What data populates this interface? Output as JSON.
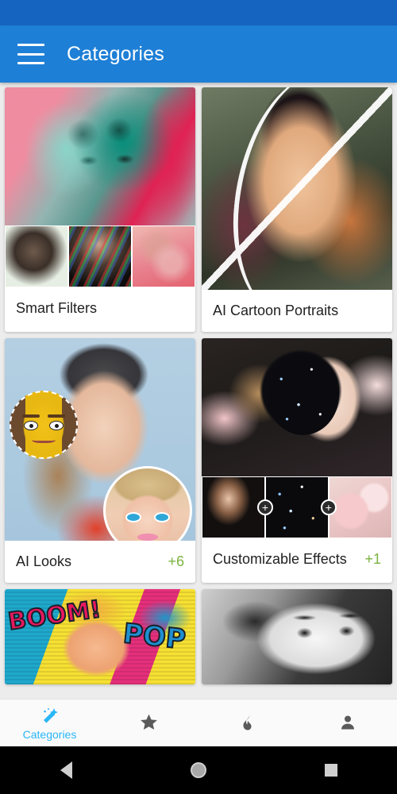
{
  "app_bar": {
    "menu_icon": "hamburger-menu-icon",
    "title": "Categories"
  },
  "categories": [
    {
      "title": "Smart Filters",
      "badge": "",
      "layout": "hero-with-thumbs",
      "thumb_count": 3
    },
    {
      "title": "AI Cartoon Portraits",
      "badge": "",
      "layout": "hero-only",
      "thumb_count": 0
    },
    {
      "title": "AI Looks",
      "badge": "+6",
      "layout": "hero-only-tall",
      "thumb_count": 0
    },
    {
      "title": "Customizable Effects",
      "badge": "+1",
      "layout": "hero-with-thumbs",
      "thumb_count": 3,
      "thumb_separator": "+"
    },
    {
      "title": "",
      "badge": "",
      "layout": "hero-only-cropped",
      "thumb_count": 0
    },
    {
      "title": "",
      "badge": "",
      "layout": "hero-only-cropped",
      "thumb_count": 0
    }
  ],
  "pop_art": {
    "word_1": "BOOM!",
    "word_2": "POP"
  },
  "bottom_nav": {
    "items": [
      {
        "icon": "magic-wand-icon",
        "label": "Categories",
        "active": true
      },
      {
        "icon": "star-icon",
        "label": "",
        "active": false
      },
      {
        "icon": "flame-icon",
        "label": "",
        "active": false
      },
      {
        "icon": "person-icon",
        "label": "",
        "active": false
      }
    ]
  },
  "system_nav": {
    "back": "back-triangle-icon",
    "home": "home-circle-icon",
    "recents": "recents-square-icon"
  },
  "colors": {
    "status_bar": "#1565c0",
    "app_bar": "#1e7fd6",
    "page_background": "#ececec",
    "card_background": "#ffffff",
    "badge_green": "#7cb342",
    "nav_active": "#29b6f6",
    "nav_inactive": "#5a5a5a"
  }
}
